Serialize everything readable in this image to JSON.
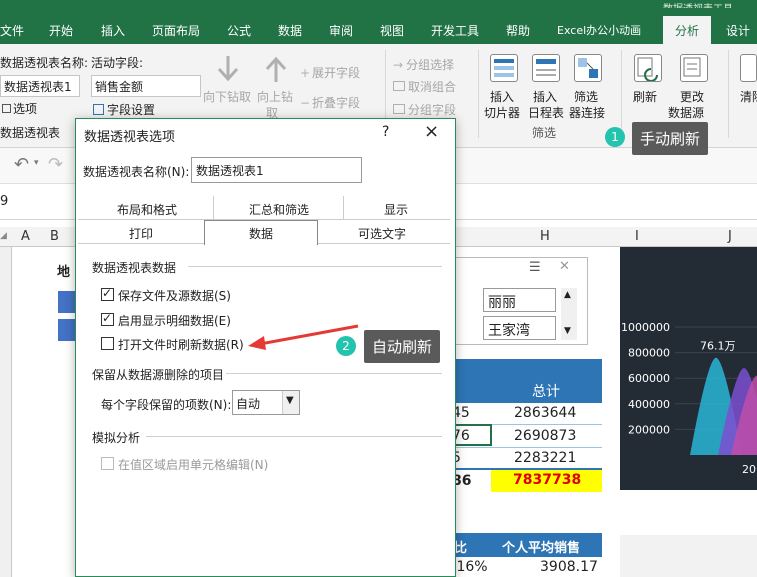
{
  "window": {
    "title_fragment": "数据透视表工具"
  },
  "ribbon": {
    "tabs": [
      "文件",
      "开始",
      "插入",
      "页面布局",
      "公式",
      "数据",
      "审阅",
      "视图",
      "开发工具",
      "帮助",
      "Excel办公小动画",
      "分析",
      "设计"
    ],
    "active_tab": "分析",
    "pivot_name_label": "数据透视表名称:",
    "pivot_name_value": "数据透视表1",
    "options_label": "选项",
    "pivot_table_label": "数据透视表",
    "active_field_label": "活动字段:",
    "active_field_value": "销售金额",
    "field_settings_label": "字段设置",
    "drill_down_label": "向下钻取",
    "drill_up_label": "向上钻",
    "drill_up_label2": "取",
    "expand_field": "展开字段",
    "collapse_field": "折叠字段",
    "group_selection": "分组选择",
    "ungroup": "取消组合",
    "group_field": "分组字段",
    "insert_slicer": [
      "插入",
      "切片器"
    ],
    "insert_timeline": [
      "插入",
      "日程表"
    ],
    "filter_connections": [
      "筛选",
      "器连接"
    ],
    "filter_group": "筛选",
    "refresh": "刷新",
    "change_source": [
      "更改",
      "数据源"
    ],
    "clear": "清除"
  },
  "name_box": "9",
  "column_headers": [
    "A",
    "B",
    "H",
    "I",
    "J"
  ],
  "dialog": {
    "title": "数据透视表选项",
    "help": "?",
    "close": "×",
    "name_label": "数据透视表名称(N):",
    "name_value": "数据透视表1",
    "tabs_row1": [
      "布局和格式",
      "汇总和筛选",
      "显示"
    ],
    "tabs_row2": [
      "打印",
      "数据",
      "可选文字"
    ],
    "active_tab": "数据",
    "section1": "数据透视表数据",
    "options": [
      {
        "label": "保存文件及源数据(S)",
        "checked": true
      },
      {
        "label": "启用显示明细数据(E)",
        "checked": true
      },
      {
        "label": "打开文件时刷新数据(R)",
        "checked": false
      }
    ],
    "section2": "保留从数据源删除的项目",
    "items_per_field_label": "每个字段保留的项数(N):",
    "items_per_field_value": "自动",
    "section3": "模拟分析",
    "whatif_label": "在值区域启用单元格编辑(N)"
  },
  "annotations": {
    "badge1": "1",
    "callout1": "手动刷新",
    "badge2": "2",
    "callout2": "自动刷新"
  },
  "sheet": {
    "left_fragment": "地",
    "slicer_items": [
      "丽丽",
      "王家湾"
    ],
    "total_header": "总计",
    "total_values": [
      "2863644",
      "2690873",
      "2283221"
    ],
    "partial_left": [
      "45",
      "76",
      "5"
    ],
    "grand_total_left": "86",
    "grand_total": "7837738",
    "bottom_header_left": "比",
    "bottom_header": "个人平均销售",
    "bottom_left_value": ".16%",
    "bottom_value": "3908.17"
  },
  "chart_data": {
    "type": "area",
    "ylim": [
      0,
      1000000
    ],
    "yticks": [
      "1000000",
      "800000",
      "600000",
      "400000",
      "200000"
    ],
    "annotation": "76.1万",
    "x_fragment": "20"
  },
  "colors": {
    "ribbon_green": "#217346",
    "badge_teal": "#23c3ae",
    "callout_gray": "#5a5a5a",
    "grand_total_bg": "#ffff00",
    "grand_total_fg": "#e00000",
    "table_header_blue": "#2e75b6",
    "arrow_red": "#e53935"
  }
}
